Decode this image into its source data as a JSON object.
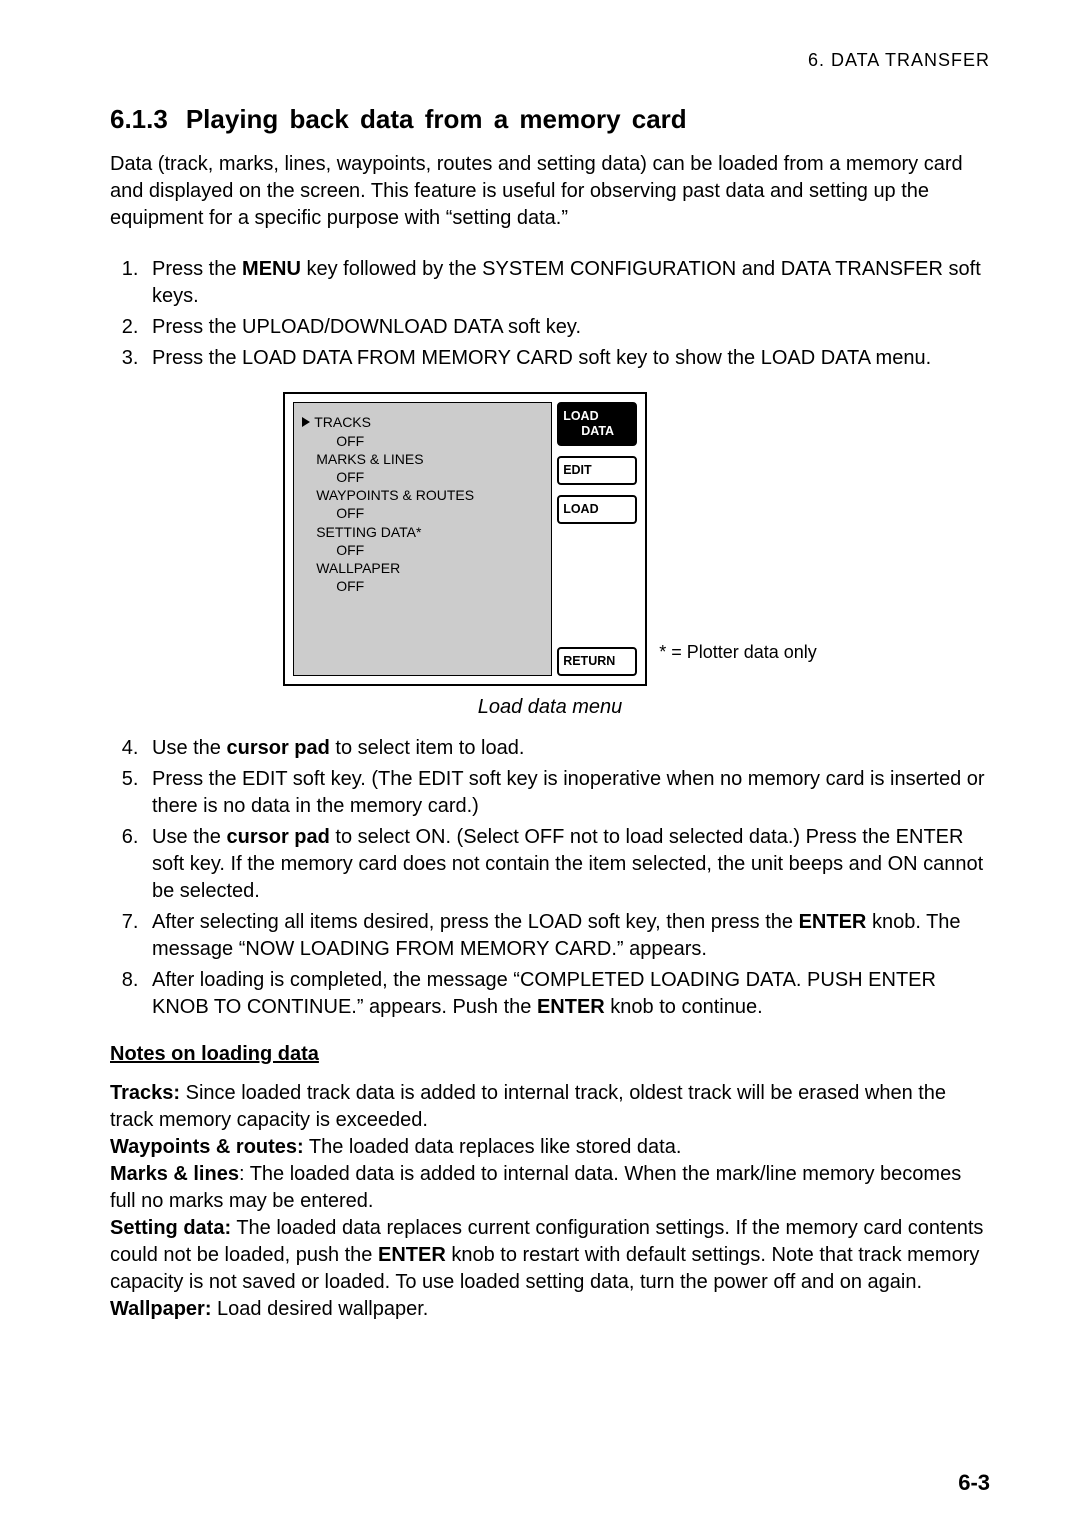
{
  "header": {
    "text": "6.  DATA  TRANSFER"
  },
  "title": {
    "number": "6.1.3",
    "text": "Playing back data from a memory card"
  },
  "intro": "Data (track, marks, lines, waypoints, routes and setting data) can be loaded from a memory card and displayed on the screen. This feature is useful for observing past data and setting up the equipment for a specific purpose with “setting data.”",
  "steps_a": [
    {
      "pre": "Press the ",
      "bold": "MENU",
      "post": " key followed by the SYSTEM CONFIGURATION and DATA TRANSFER soft keys."
    },
    {
      "pre": "Press the UPLOAD/DOWNLOAD DATA soft key.",
      "bold": "",
      "post": ""
    },
    {
      "pre": "Press the LOAD DATA FROM MEMORY CARD soft key to show the LOAD DATA menu.",
      "bold": "",
      "post": ""
    }
  ],
  "screen": {
    "items": [
      {
        "label": "TRACKS",
        "value": "OFF",
        "pointer": true
      },
      {
        "label": "MARKS & LINES",
        "value": "OFF",
        "pointer": false
      },
      {
        "label": "WAYPOINTS & ROUTES",
        "value": "OFF",
        "pointer": false
      },
      {
        "label": "SETTING DATA*",
        "value": "OFF",
        "pointer": false
      },
      {
        "label": "WALLPAPER",
        "value": "OFF",
        "pointer": false
      }
    ],
    "softkeys": {
      "top": {
        "line1": "LOAD",
        "line2": "DATA"
      },
      "edit": "EDIT",
      "load": "LOAD",
      "return": "RETURN"
    },
    "footnote": "* = Plotter data only",
    "caption": "Load data menu"
  },
  "steps_b": [
    {
      "parts": [
        "Use the ",
        "cursor pad",
        " to select item to load."
      ],
      "bolds": [
        1
      ]
    },
    {
      "parts": [
        "Press the EDIT soft key. (The EDIT soft key is inoperative when no memory card is inserted or there is no data in the memory card.)"
      ],
      "bolds": []
    },
    {
      "parts": [
        "Use the ",
        "cursor pad",
        " to select ON. (Select OFF not to load selected data.) Press the ENTER soft key. If the memory card does not contain the item selected, the unit beeps and ON cannot be selected."
      ],
      "bolds": [
        1
      ]
    },
    {
      "parts": [
        "After selecting all items desired, press the LOAD soft key, then press the ",
        "ENTER",
        " knob. The message “NOW LOADING FROM MEMORY CARD.” appears."
      ],
      "bolds": [
        1
      ]
    },
    {
      "parts": [
        "After loading is completed, the message “COMPLETED LOADING DATA. PUSH ENTER KNOB TO CONTINUE.” appears. Push the ",
        "ENTER",
        " knob to continue."
      ],
      "bolds": [
        1
      ]
    }
  ],
  "notes": {
    "heading": "Notes on loading data",
    "tracks": {
      "label": "Tracks:",
      "text": " Since loaded track data is added to internal track, oldest track will be erased when the track memory capacity is exceeded."
    },
    "wproutes": {
      "label": "Waypoints & routes:",
      "text": " The loaded data replaces like stored data."
    },
    "marks": {
      "label": "Marks & lines",
      "text": ": The loaded data is added to internal data. When the mark/line memory becomes full no marks may be entered."
    },
    "setting": {
      "label": "Setting data:",
      "text": " The loaded data replaces current configuration settings. If the memory card contents could not be loaded, push the ",
      "bold": "ENTER",
      "text2": " knob to restart with default settings. Note that track memory capacity is not saved or loaded. To use loaded setting data, turn the power off and on again."
    },
    "wallpaper": {
      "label": "Wallpaper:",
      "text": " Load desired wallpaper."
    }
  },
  "page_number": "6-3"
}
